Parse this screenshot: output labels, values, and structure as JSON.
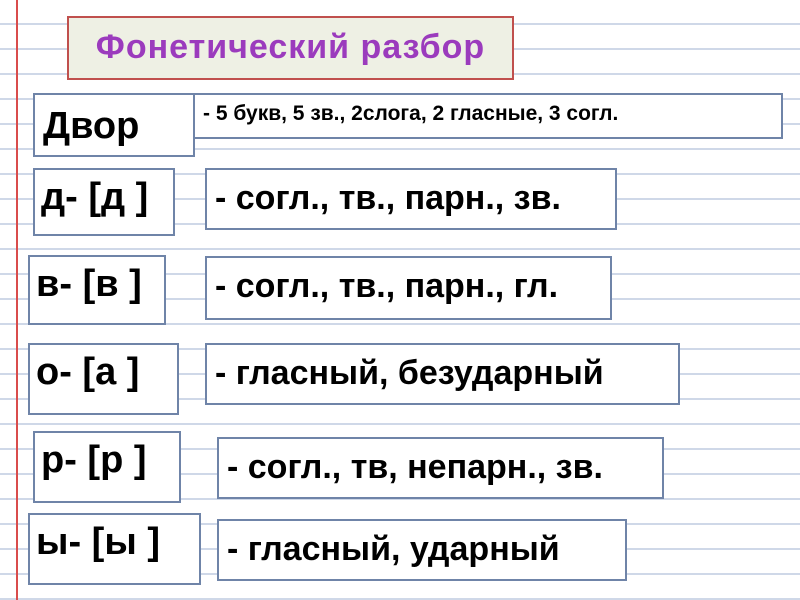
{
  "title": "Фонетический разбор",
  "word": {
    "text": "Двор",
    "description": "- 5 букв, 5 зв., 2слога, 2 гласные, 3 согл."
  },
  "rows": [
    {
      "letter": "д- [д ]",
      "description": "- согл., тв., парн., зв."
    },
    {
      "letter": "в- [в ]",
      "description": "- согл., тв., парн., гл."
    },
    {
      "letter": "о- [а ]",
      "description": "- гласный, безударный"
    },
    {
      "letter": "р- [р ]",
      "description": "- согл., тв, непарн., зв."
    },
    {
      "letter": "ы- [ы ]",
      "description": "- гласный, ударный"
    }
  ]
}
